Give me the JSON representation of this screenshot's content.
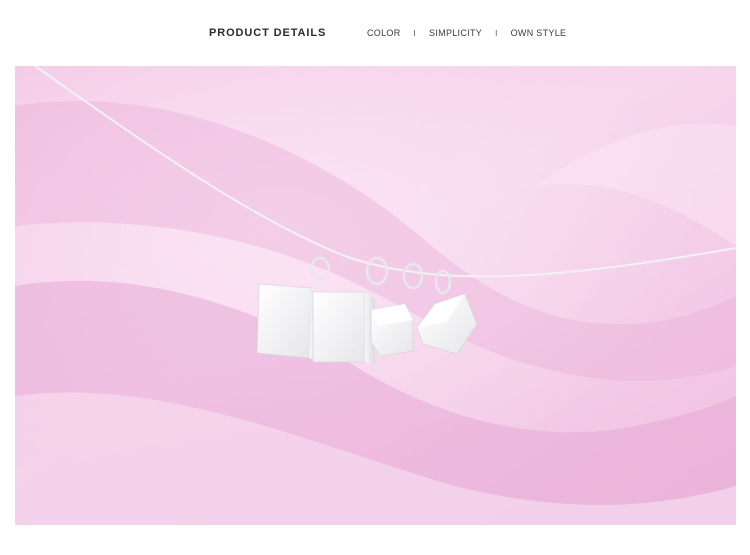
{
  "header": {
    "title": "PRODUCT DETAILS",
    "tags": [
      "COLOR",
      "SIMPLICITY",
      "OWN STYLE"
    ],
    "separator": "I"
  },
  "photo": {
    "subject": "silver-cube-pendant-necklace",
    "colors": {
      "fabric_light": "#f6d3ea",
      "fabric_mid": "#efbadf",
      "fabric_shadow": "#e6a8d3",
      "silver": "#f4f4f6"
    }
  }
}
